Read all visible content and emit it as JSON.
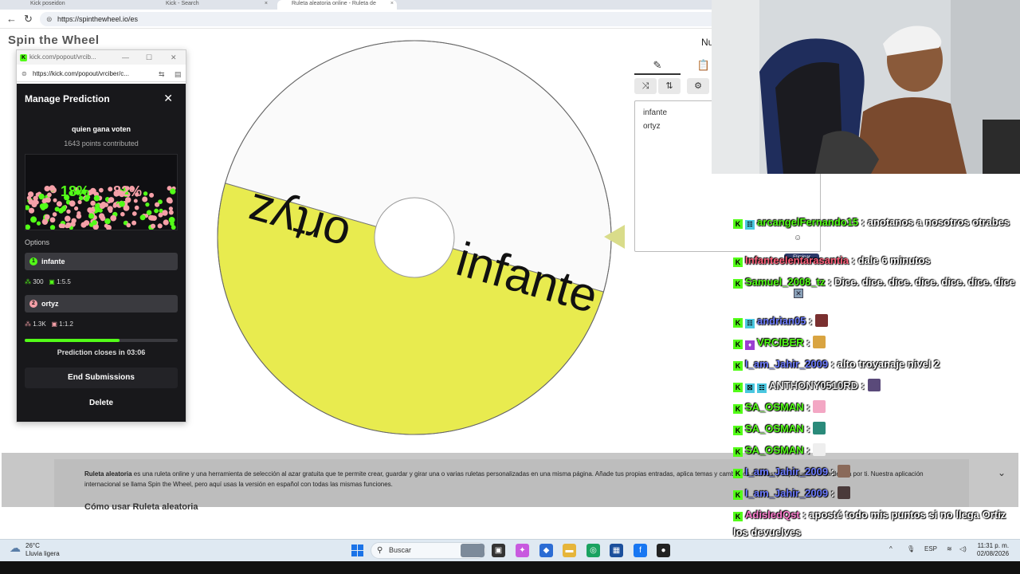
{
  "browser": {
    "tabs": [
      {
        "label": "Kick poseidon"
      },
      {
        "label": "Kick - Search"
      },
      {
        "label": "Ruleta aleatoria online - Ruleta de"
      }
    ],
    "url": "https://spinthewheel.io/es"
  },
  "page": {
    "logo": "Spin the Wheel",
    "nu_text": "Nu",
    "wheel": {
      "segments": [
        {
          "label": "ortyz",
          "color": "#fafafa"
        },
        {
          "label": "infante",
          "color": "#e8eb4f"
        }
      ]
    },
    "tools": {
      "entries": [
        "infante",
        "ortyz"
      ]
    },
    "info": {
      "bold_lead": "Ruleta aleatoria",
      "text": " es una ruleta online y una herramienta de selección al azar gratuita que te permite crear, guardar y girar una o varias ruletas personalizadas en una misma página. Añade tus propias entradas, aplica temas y cambia los sonidos, y deja que la ruleta decida por ti. Nuestra aplicación internacional se llama Spin the Wheel, pero aquí usas la versión en español con todas las mismas funciones.",
      "heading": "Cómo usar Ruleta aleatoria"
    }
  },
  "popout": {
    "window_title": "kick.com/popout/vrcib...",
    "url": "https://kick.com/popout/vrciber/c...",
    "title": "Manage Prediction",
    "question": "quien gana voten",
    "points": "1643 points contributed",
    "pct_a": "18%",
    "pct_b": "82%",
    "options_label": "Options",
    "options": [
      {
        "num": "1",
        "name": "infante",
        "points": "300",
        "ratio": "1:5.5",
        "color": "#53fc18"
      },
      {
        "num": "2",
        "name": "ortyz",
        "points": "1.3K",
        "ratio": "1:1.2",
        "color": "#f5a0a8"
      }
    ],
    "progress": 0.62,
    "closes": "Prediction closes in 03:06",
    "end_button": "End Submissions",
    "delete_button": "Delete"
  },
  "chat": {
    "messages": [
      {
        "user": "arcangelFernando15",
        "text": " : anotanos a nosotros otrabes",
        "color": "#53fc18"
      },
      {
        "user": "Infanteelentarasantia",
        "text": " : dale 6 minutos",
        "color": "#ff5f7a"
      },
      {
        "user": "Samuel_2008_tz",
        "text": " : Dice. dice. dice. dice. dice. dice. dice",
        "color": "#53fc18"
      },
      {
        "user": "andrian05",
        "text": " :",
        "color": "#6d7cff"
      },
      {
        "user": "VRCIBER",
        "text": " :",
        "color": "#53fc18"
      },
      {
        "user": "I_am_Jahir_2009",
        "text": " : alto troyanaje nivel 2",
        "color": "#6d7cff"
      },
      {
        "user": "ANTHONY0510RD",
        "text": " :",
        "color": "#e8e8e8"
      },
      {
        "user": "SA_OSMAN",
        "text": " :",
        "color": "#53fc18"
      },
      {
        "user": "SA_OSMAN",
        "text": " :",
        "color": "#53fc18"
      },
      {
        "user": "SA_OSMAN",
        "text": " :",
        "color": "#53fc18"
      },
      {
        "user": "I_am_Jahir_2009",
        "text": " :",
        "color": "#6d7cff"
      },
      {
        "user": "I_am_Jahir_2009",
        "text": " :",
        "color": "#6d7cff"
      },
      {
        "user": "AdisledQst",
        "text": " : aposté todo mis puntos si no llega Ortiz los devuelves",
        "color": "#ff7fd0"
      }
    ],
    "tooltip": "Eliminar"
  },
  "taskbar": {
    "weather_temp": "26°C",
    "weather_desc": "Lluvia ligera",
    "search": "Buscar",
    "lang": "ESP",
    "time": "11:31 p. m.",
    "date": "02/08/2026"
  }
}
